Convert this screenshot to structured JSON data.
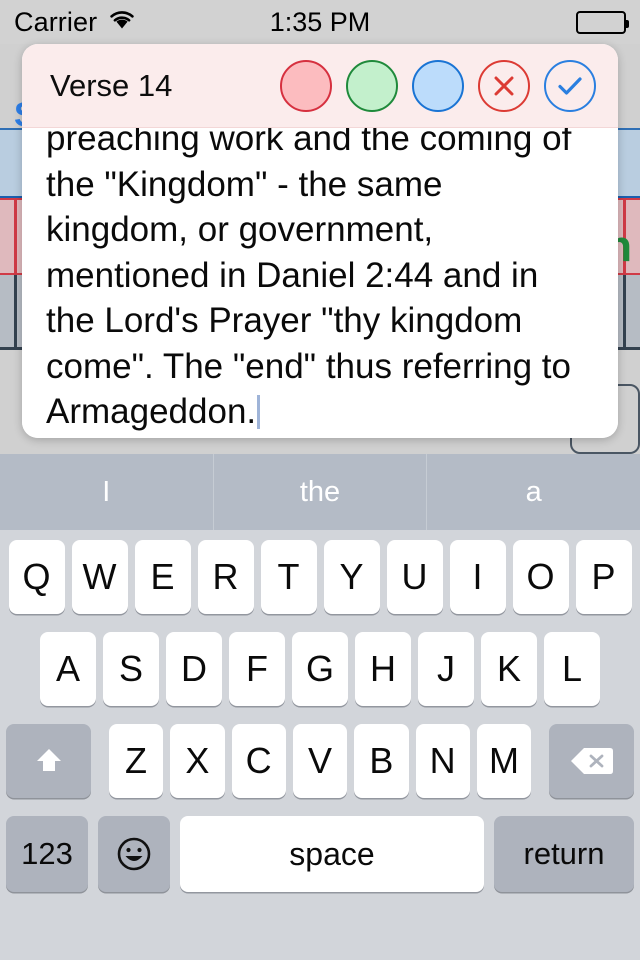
{
  "status_bar": {
    "carrier": "Carrier",
    "wifi_icon": "wifi-icon",
    "time": "1:35 PM",
    "battery_icon": "battery-full-icon"
  },
  "background": {
    "left_badge": "S",
    "right_letter": "h",
    "row_colors": [
      "#b9cde0",
      "#dfb9bd",
      "#b6bcc4",
      "#d0d0d0"
    ],
    "right_row_colors": [
      "#bdd6c6",
      "#dfb9bd",
      "#b6bcc4"
    ]
  },
  "popup": {
    "title": "Verse 14",
    "buttons": [
      {
        "name": "color-pink-button",
        "label": "",
        "fill": "#fcbcbf",
        "stroke": "#d6303f",
        "icon": "circle-icon"
      },
      {
        "name": "color-green-button",
        "label": "",
        "fill": "#c3f0cc",
        "stroke": "#1f8a3b",
        "icon": "circle-icon"
      },
      {
        "name": "color-blue-button",
        "label": "",
        "fill": "#bcdcfb",
        "stroke": "#1a74d4",
        "icon": "circle-icon"
      },
      {
        "name": "cancel-button",
        "label": "",
        "fill": "none",
        "stroke": "#dc3b34",
        "icon": "x-circle-icon"
      },
      {
        "name": "confirm-button",
        "label": "",
        "fill": "none",
        "stroke": "#2a7fe0",
        "icon": "check-circle-icon"
      }
    ],
    "note_text": "preaching work and the coming of the \"Kingdom\" - the same kingdom, or government, mentioned in Daniel 2:44 and in the Lord's Prayer \"thy kingdom come\". The \"end\" thus referring to Armageddon.",
    "header_bg": "#fbecec"
  },
  "keyboard": {
    "suggestions": [
      "I",
      "the",
      "a"
    ],
    "row1": [
      "Q",
      "W",
      "E",
      "R",
      "T",
      "Y",
      "U",
      "I",
      "O",
      "P"
    ],
    "row2": [
      "A",
      "S",
      "D",
      "F",
      "G",
      "H",
      "J",
      "K",
      "L"
    ],
    "row3": [
      "Z",
      "X",
      "C",
      "V",
      "B",
      "N",
      "M"
    ],
    "shift_icon": "shift-arrow-icon",
    "delete_icon": "backspace-icon",
    "numbers_key": "123",
    "emoji_icon": "emoji-smiley-icon",
    "space_key": "space",
    "return_key": "return"
  }
}
